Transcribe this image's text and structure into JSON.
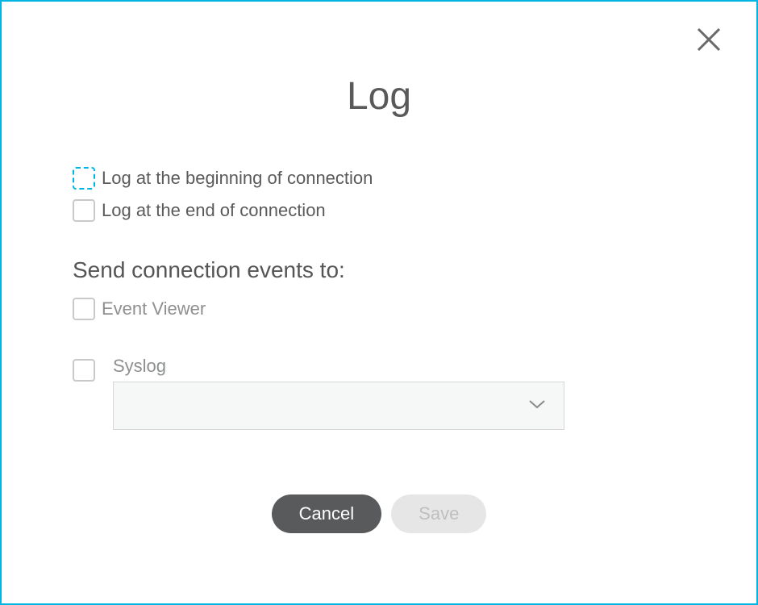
{
  "dialog": {
    "title": "Log",
    "close_icon": "close-icon"
  },
  "options": {
    "log_begin_label": "Log at the beginning of connection",
    "log_end_label": "Log at the end of connection"
  },
  "section": {
    "heading": "Send connection events to:",
    "event_viewer_label": "Event Viewer",
    "syslog_label": "Syslog",
    "syslog_selected": ""
  },
  "buttons": {
    "cancel": "Cancel",
    "save": "Save"
  },
  "colors": {
    "accent": "#00b5e2",
    "text_primary": "#5a5a5a",
    "text_muted": "#8d8f90",
    "btn_dark": "#595a5c",
    "btn_disabled_bg": "#e6e6e6",
    "btn_disabled_fg": "#bfbfbf"
  },
  "state": {
    "log_begin_checked": false,
    "log_begin_focused": true,
    "log_end_checked": false,
    "event_viewer_checked": false,
    "syslog_checked": false,
    "save_enabled": false
  }
}
